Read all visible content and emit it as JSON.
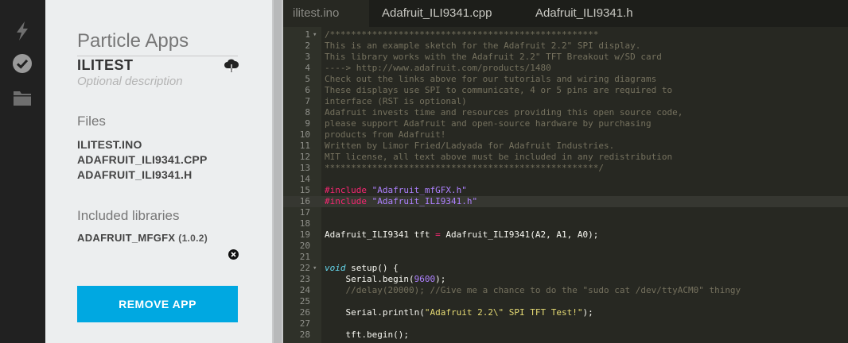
{
  "sidebar_icons": [
    {
      "name": "flash-icon",
      "color": "#6f6f6f"
    },
    {
      "name": "verify-icon",
      "color": "#9a9a9a"
    },
    {
      "name": "folder-icon",
      "color": "#6f6f6f"
    }
  ],
  "panel": {
    "heading": "Particle Apps",
    "app_name": "ILITEST",
    "description_placeholder": "Optional description",
    "files_heading": "Files",
    "files": [
      "ILITEST.INO",
      "ADAFRUIT_ILI9341.CPP",
      "ADAFRUIT_ILI9341.H"
    ],
    "libraries_heading": "Included libraries",
    "library": {
      "name": "ADAFRUIT_MFGFX",
      "version": "(1.0.2)"
    },
    "remove_button": "REMOVE APP"
  },
  "tabs": [
    {
      "label": "ilitest.ino",
      "active": true
    },
    {
      "label": "Adafruit_ILI9341.cpp",
      "active": false
    },
    {
      "label": "Adafruit_ILI9341.h",
      "active": false
    }
  ],
  "code": {
    "highlighted_line": 16,
    "lines": [
      {
        "n": "1",
        "fold": true,
        "t": [
          [
            "c-comment",
            "/***************************************************"
          ]
        ]
      },
      {
        "n": "2",
        "t": [
          [
            "c-comment",
            "This is an example sketch for the Adafruit 2.2\" SPI display."
          ]
        ]
      },
      {
        "n": "3",
        "t": [
          [
            "c-comment",
            "This library works with the Adafruit 2.2\" TFT Breakout w/SD card"
          ]
        ]
      },
      {
        "n": "4",
        "t": [
          [
            "c-comment",
            "----> http://www.adafruit.com/products/1480"
          ]
        ]
      },
      {
        "n": "5",
        "t": [
          [
            "c-comment",
            "Check out the links above for our tutorials and wiring diagrams"
          ]
        ]
      },
      {
        "n": "6",
        "t": [
          [
            "c-comment",
            "These displays use SPI to communicate, 4 or 5 pins are required to"
          ]
        ]
      },
      {
        "n": "7",
        "t": [
          [
            "c-comment",
            "interface (RST is optional)"
          ]
        ]
      },
      {
        "n": "8",
        "t": [
          [
            "c-comment",
            "Adafruit invests time and resources providing this open source code,"
          ]
        ]
      },
      {
        "n": "9",
        "t": [
          [
            "c-comment",
            "please support Adafruit and open-source hardware by purchasing"
          ]
        ]
      },
      {
        "n": "10",
        "t": [
          [
            "c-comment",
            "products from Adafruit!"
          ]
        ]
      },
      {
        "n": "11",
        "t": [
          [
            "c-comment",
            "Written by Limor Fried/Ladyada for Adafruit Industries."
          ]
        ]
      },
      {
        "n": "12",
        "t": [
          [
            "c-comment",
            "MIT license, all text above must be included in any redistribution"
          ]
        ]
      },
      {
        "n": "13",
        "t": [
          [
            "c-comment",
            "****************************************************/"
          ]
        ]
      },
      {
        "n": "14",
        "t": []
      },
      {
        "n": "15",
        "t": [
          [
            "c-pre",
            "#include "
          ],
          [
            "c-inc",
            "\"Adafruit_mfGFX.h\""
          ]
        ]
      },
      {
        "n": "16",
        "t": [
          [
            "c-pre",
            "#include "
          ],
          [
            "c-inc",
            "\"Adafruit_ILI9341.h\""
          ]
        ]
      },
      {
        "n": "17",
        "t": []
      },
      {
        "n": "18",
        "t": []
      },
      {
        "n": "19",
        "t": [
          [
            "",
            "Adafruit_ILI9341 tft "
          ],
          [
            "c-op",
            "="
          ],
          [
            "",
            " Adafruit_ILI9341(A2, A1, A0);"
          ]
        ]
      },
      {
        "n": "20",
        "t": []
      },
      {
        "n": "21",
        "t": []
      },
      {
        "n": "22",
        "fold": true,
        "t": [
          [
            "c-kw",
            "void"
          ],
          [
            "",
            " setup() {"
          ]
        ]
      },
      {
        "n": "23",
        "t": [
          [
            "",
            "    Serial.begin("
          ],
          [
            "c-num",
            "9600"
          ],
          [
            "",
            ");"
          ]
        ]
      },
      {
        "n": "24",
        "t": [
          [
            "c-comment",
            "    //delay(20000); //Give me a chance to do the \"sudo cat /dev/ttyACM0\" thingy"
          ]
        ]
      },
      {
        "n": "25",
        "t": []
      },
      {
        "n": "26",
        "t": [
          [
            "",
            "    Serial.println("
          ],
          [
            "c-str",
            "\"Adafruit 2.2\\\" SPI TFT Test!\""
          ],
          [
            "",
            ");"
          ]
        ]
      },
      {
        "n": "27",
        "t": []
      },
      {
        "n": "28",
        "t": [
          [
            "",
            "    tft.begin();"
          ]
        ]
      }
    ]
  }
}
